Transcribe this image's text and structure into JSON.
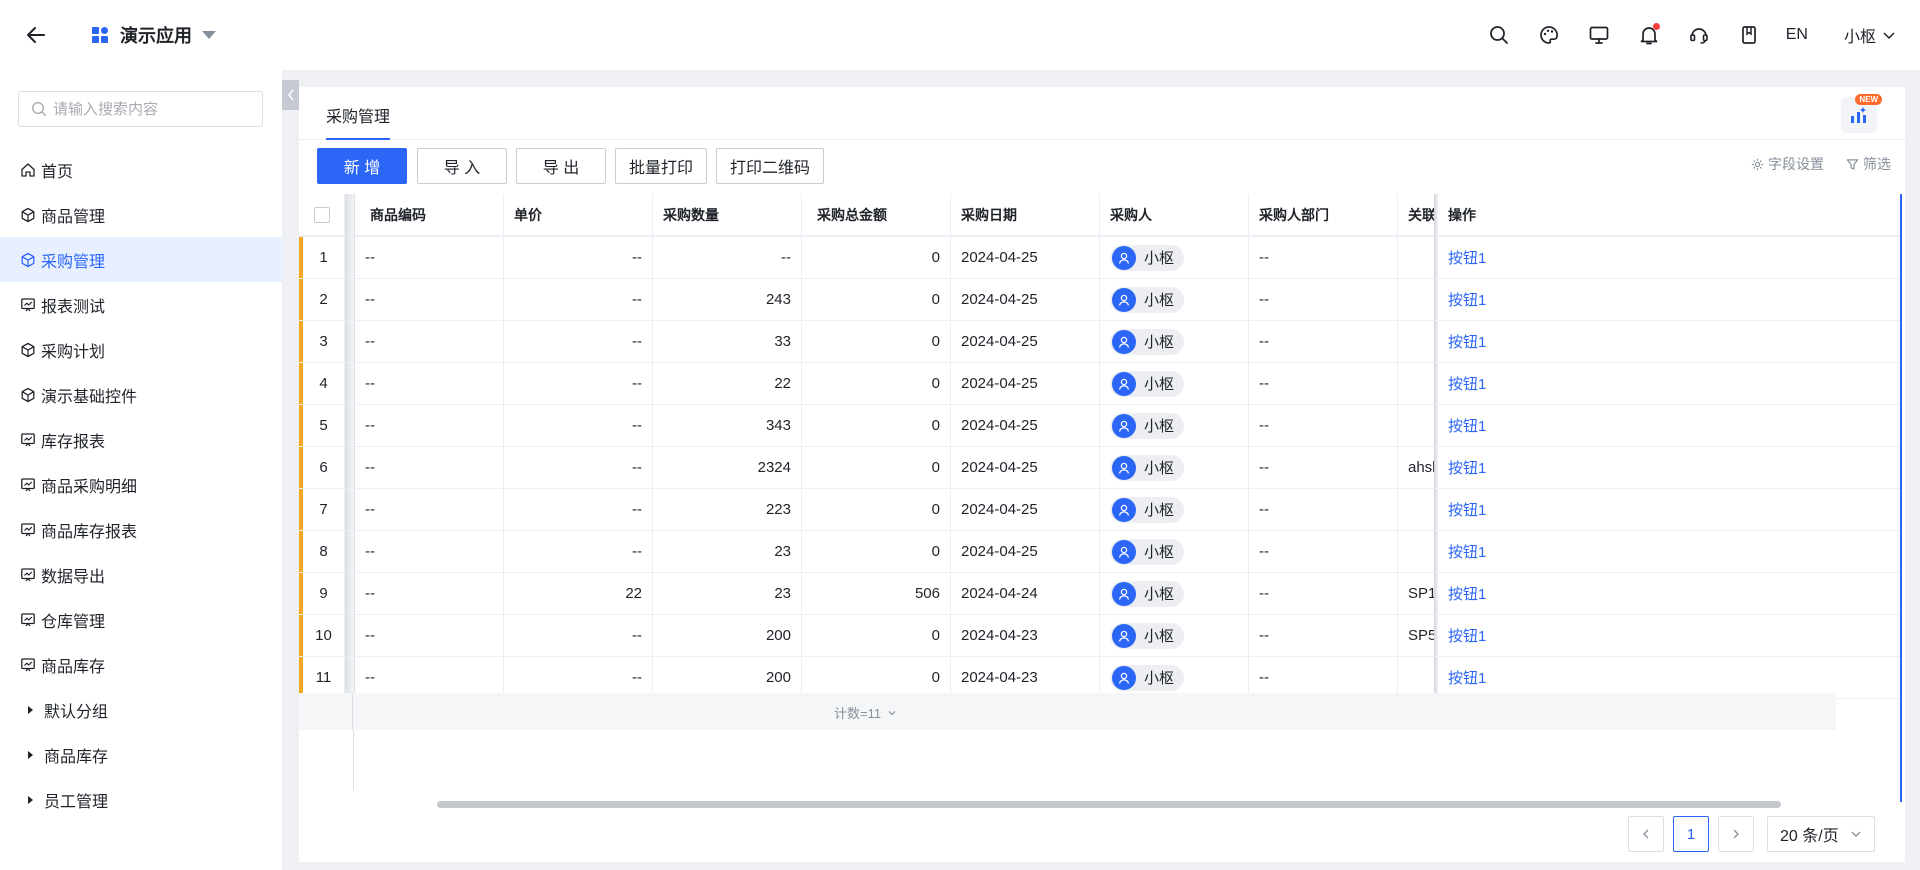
{
  "app": {
    "title": "演示应用"
  },
  "header": {
    "lang": "EN",
    "user": "小枢"
  },
  "sidebar": {
    "search_placeholder": "请输入搜索内容",
    "items": [
      {
        "label": "首页",
        "icon": "home-icon"
      },
      {
        "label": "商品管理",
        "icon": "cube-icon"
      },
      {
        "label": "采购管理",
        "icon": "cube-icon"
      },
      {
        "label": "报表测试",
        "icon": "chart-board-icon"
      },
      {
        "label": "采购计划",
        "icon": "cube-icon"
      },
      {
        "label": "演示基础控件",
        "icon": "cube-icon"
      },
      {
        "label": "库存报表",
        "icon": "chart-board-icon"
      },
      {
        "label": "商品采购明细",
        "icon": "chart-board-icon"
      },
      {
        "label": "商品库存报表",
        "icon": "chart-board-icon"
      },
      {
        "label": "数据导出",
        "icon": "chart-board-icon"
      },
      {
        "label": "仓库管理",
        "icon": "chart-board-icon"
      },
      {
        "label": "商品库存",
        "icon": "chart-board-icon"
      }
    ],
    "groups": [
      {
        "label": "默认分组"
      },
      {
        "label": "商品库存"
      },
      {
        "label": "员工管理"
      }
    ]
  },
  "tabs": {
    "active": "采购管理",
    "ai_badge": "NEW"
  },
  "toolbar": {
    "add": "新 增",
    "import": "导 入",
    "export": "导 出",
    "batch_print": "批量打印",
    "print_qr": "打印二维码",
    "field_settings": "字段设置",
    "filter": "筛选"
  },
  "table": {
    "columns": {
      "code": "商品编码",
      "price": "单价",
      "qty": "采购数量",
      "total": "采购总金额",
      "date": "采购日期",
      "buyer": "采购人",
      "dept": "采购人部门",
      "rel": "关联",
      "op": "操作"
    },
    "rows": [
      {
        "idx": "1",
        "code": "--",
        "price": "--",
        "qty": "--",
        "total": "0",
        "date": "2024-04-25",
        "buyer": "小枢",
        "dept": "--",
        "rel": "",
        "op": "按钮1"
      },
      {
        "idx": "2",
        "code": "--",
        "price": "--",
        "qty": "243",
        "total": "0",
        "date": "2024-04-25",
        "buyer": "小枢",
        "dept": "--",
        "rel": "",
        "op": "按钮1"
      },
      {
        "idx": "3",
        "code": "--",
        "price": "--",
        "qty": "33",
        "total": "0",
        "date": "2024-04-25",
        "buyer": "小枢",
        "dept": "--",
        "rel": "",
        "op": "按钮1"
      },
      {
        "idx": "4",
        "code": "--",
        "price": "--",
        "qty": "22",
        "total": "0",
        "date": "2024-04-25",
        "buyer": "小枢",
        "dept": "--",
        "rel": "",
        "op": "按钮1"
      },
      {
        "idx": "5",
        "code": "--",
        "price": "--",
        "qty": "343",
        "total": "0",
        "date": "2024-04-25",
        "buyer": "小枢",
        "dept": "--",
        "rel": "",
        "op": "按钮1"
      },
      {
        "idx": "6",
        "code": "--",
        "price": "--",
        "qty": "2324",
        "total": "0",
        "date": "2024-04-25",
        "buyer": "小枢",
        "dept": "--",
        "rel": "ahshd",
        "op": "按钮1"
      },
      {
        "idx": "7",
        "code": "--",
        "price": "--",
        "qty": "223",
        "total": "0",
        "date": "2024-04-25",
        "buyer": "小枢",
        "dept": "--",
        "rel": "",
        "op": "按钮1"
      },
      {
        "idx": "8",
        "code": "--",
        "price": "--",
        "qty": "23",
        "total": "0",
        "date": "2024-04-25",
        "buyer": "小枢",
        "dept": "--",
        "rel": "",
        "op": "按钮1"
      },
      {
        "idx": "9",
        "code": "--",
        "price": "22",
        "qty": "23",
        "total": "506",
        "date": "2024-04-24",
        "buyer": "小枢",
        "dept": "--",
        "rel": "SP1",
        "op": "按钮1"
      },
      {
        "idx": "10",
        "code": "--",
        "price": "--",
        "qty": "200",
        "total": "0",
        "date": "2024-04-23",
        "buyer": "小枢",
        "dept": "--",
        "rel": "SP5",
        "op": "按钮1"
      },
      {
        "idx": "11",
        "code": "--",
        "price": "--",
        "qty": "200",
        "total": "0",
        "date": "2024-04-23",
        "buyer": "小枢",
        "dept": "--",
        "rel": "",
        "op": "按钮1"
      }
    ],
    "count_label": "计数=11"
  },
  "pagination": {
    "current": "1",
    "page_size": "20 条/页"
  },
  "colors": {
    "primary": "#2b66f6",
    "row_stripe": "#f5a623",
    "badge": "#ff6a2a",
    "notify_dot": "#f53f3f"
  }
}
